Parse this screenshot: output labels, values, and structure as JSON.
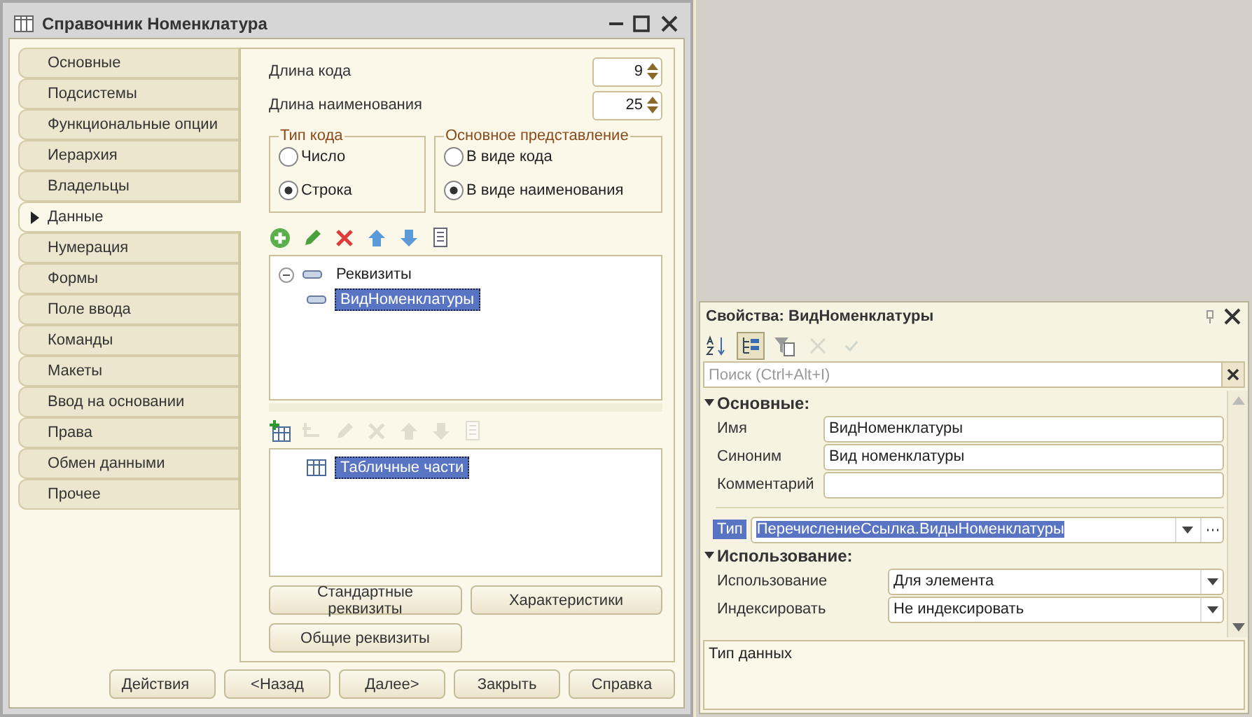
{
  "window": {
    "title": "Справочник Номенклатура"
  },
  "tabs": [
    {
      "label": "Основные",
      "selected": false
    },
    {
      "label": "Подсистемы",
      "selected": false
    },
    {
      "label": "Функциональные опции",
      "selected": false
    },
    {
      "label": "Иерархия",
      "selected": false
    },
    {
      "label": "Владельцы",
      "selected": false
    },
    {
      "label": "Данные",
      "selected": true
    },
    {
      "label": "Нумерация",
      "selected": false
    },
    {
      "label": "Формы",
      "selected": false
    },
    {
      "label": "Поле ввода",
      "selected": false
    },
    {
      "label": "Команды",
      "selected": false
    },
    {
      "label": "Макеты",
      "selected": false
    },
    {
      "label": "Ввод на основании",
      "selected": false
    },
    {
      "label": "Права",
      "selected": false
    },
    {
      "label": "Обмен данными",
      "selected": false
    },
    {
      "label": "Прочее",
      "selected": false
    }
  ],
  "spinners": [
    {
      "label": "Длина кода",
      "value": "9"
    },
    {
      "label": "Длина наименования",
      "value": "25"
    }
  ],
  "groups": [
    {
      "title": "Тип кода",
      "options": [
        {
          "label": "Число",
          "selected": false
        },
        {
          "label": "Строка",
          "selected": true
        }
      ]
    },
    {
      "title": "Основное представление",
      "options": [
        {
          "label": "В виде кода",
          "selected": false
        },
        {
          "label": "В виде наименования",
          "selected": true
        }
      ]
    }
  ],
  "attributes_toolbar": [
    {
      "kind": "add",
      "disabled": false
    },
    {
      "kind": "edit",
      "disabled": false
    },
    {
      "kind": "delete",
      "disabled": false
    },
    {
      "kind": "up",
      "disabled": false
    },
    {
      "kind": "down",
      "disabled": false
    },
    {
      "kind": "list",
      "disabled": false
    }
  ],
  "attributes_tree": [
    {
      "label": "Реквизиты",
      "expanded": true,
      "selected": false,
      "children": [
        {
          "label": "ВидНоменклатуры",
          "selected": true
        }
      ]
    }
  ],
  "tables_toolbar": [
    {
      "kind": "add-table",
      "disabled": false
    },
    {
      "kind": "add-row",
      "disabled": true
    },
    {
      "kind": "edit",
      "disabled": true
    },
    {
      "kind": "delete",
      "disabled": true
    },
    {
      "kind": "up",
      "disabled": true
    },
    {
      "kind": "down",
      "disabled": true
    },
    {
      "kind": "list",
      "disabled": true
    }
  ],
  "tables_tree": [
    {
      "label": "Табличные части",
      "selected": true
    }
  ],
  "data_buttons": [
    "Стандартные реквизиты",
    "Характеристики",
    "Общие реквизиты"
  ],
  "footer_buttons": [
    {
      "label": "Действия",
      "kind": "menu"
    },
    {
      "label": "<Назад",
      "kind": "plain"
    },
    {
      "label": "Далее>",
      "kind": "plain"
    },
    {
      "label": "Закрыть",
      "kind": "plain"
    },
    {
      "label": "Справка",
      "kind": "plain"
    }
  ],
  "properties": {
    "title": "Свойства: ВидНоменклатуры",
    "toolbar": [
      {
        "kind": "sort",
        "pressed": false,
        "disabled": false
      },
      {
        "kind": "tree",
        "pressed": true,
        "disabled": false
      },
      {
        "kind": "filter",
        "pressed": false,
        "disabled": false
      },
      {
        "kind": "cancel",
        "pressed": false,
        "disabled": true
      },
      {
        "kind": "ok",
        "pressed": false,
        "disabled": true
      }
    ],
    "search": {
      "placeholder": "Поиск (Ctrl+Alt+I)"
    },
    "sections": [
      {
        "title": "Основные:",
        "expanded": true,
        "rows": [
          {
            "label": "Имя",
            "value": "ВидНоменклатуры",
            "kind": "text"
          },
          {
            "label": "Синоним",
            "value": "Вид номенклатуры",
            "kind": "text"
          },
          {
            "label": "Комментарий",
            "kind": "text"
          },
          {
            "label": "Тип",
            "value": "ПеречислениеСсылка.ВидыНоменклатуры",
            "kind": "type",
            "selected": true
          }
        ]
      },
      {
        "title": "Использование:",
        "expanded": true,
        "rows": [
          {
            "label": "Использование",
            "value": "Для элемента",
            "kind": "select"
          },
          {
            "label": "Индексировать",
            "value": "Не индексировать",
            "kind": "select"
          }
        ]
      }
    ],
    "description": "Тип данных"
  }
}
